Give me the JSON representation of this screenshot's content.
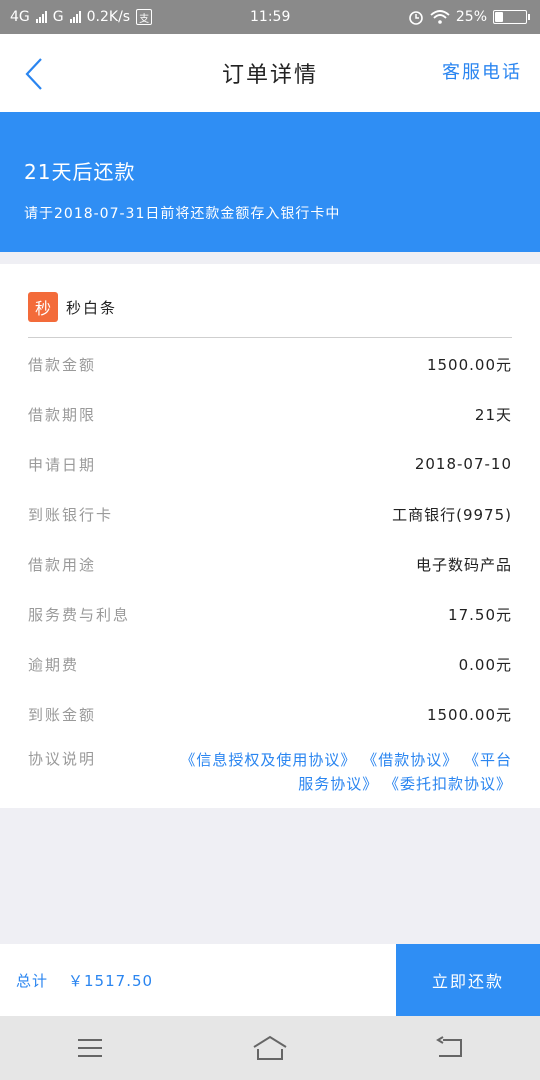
{
  "status_bar": {
    "network1": "4G",
    "network2": "G",
    "speed": "0.2K/s",
    "pay_icon": "支",
    "time": "11:59",
    "battery": "25%",
    "battery_level": 0.25
  },
  "nav": {
    "title": "订单详情",
    "service": "客服电话"
  },
  "banner": {
    "title": "21天后还款",
    "subtitle": "请于2018-07-31日前将还款金额存入银行卡中"
  },
  "brand": {
    "logo_char": "秒",
    "name": "秒白条"
  },
  "details": [
    {
      "label": "借款金额",
      "value": "1500.00元"
    },
    {
      "label": "借款期限",
      "value": "21天"
    },
    {
      "label": "申请日期",
      "value": "2018-07-10"
    },
    {
      "label": "到账银行卡",
      "value": "工商银行(9975)"
    },
    {
      "label": "借款用途",
      "value": "电子数码产品"
    },
    {
      "label": "服务费与利息",
      "value": "17.50元"
    },
    {
      "label": "逾期费",
      "value": "0.00元"
    },
    {
      "label": "到账金额",
      "value": "1500.00元"
    }
  ],
  "agreement": {
    "label": "协议说明",
    "links": [
      "《信息授权及使用协议》",
      "《借款协议》",
      "《平台服务协议》",
      "《委托扣款协议》"
    ]
  },
  "footer": {
    "total_label": "总计",
    "total_value": "￥1517.50",
    "repay_button": "立即还款"
  },
  "colors": {
    "accent": "#2f8ef4",
    "link": "#2a85f0",
    "brand_logo": "#f36b3a"
  }
}
